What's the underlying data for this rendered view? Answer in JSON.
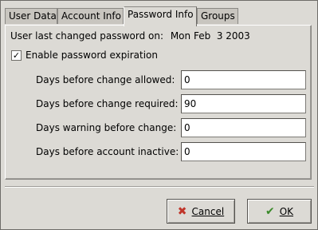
{
  "tabs": [
    {
      "label": "User Data"
    },
    {
      "label": "Account Info"
    },
    {
      "label": "Password Info"
    },
    {
      "label": "Groups"
    }
  ],
  "last_changed": {
    "label": "User last changed password on:",
    "value": "Mon Feb  3 2003"
  },
  "enable_expiration": {
    "label": "Enable password expiration",
    "checked": true
  },
  "fields": [
    {
      "label": "Days before change allowed:",
      "value": "0"
    },
    {
      "label": "Days before change required:",
      "value": "90"
    },
    {
      "label": "Days warning before change:",
      "value": "0"
    },
    {
      "label": "Days before account inactive:",
      "value": "0"
    }
  ],
  "buttons": {
    "cancel": {
      "label": "Cancel",
      "icon": "cancel-x-icon",
      "icon_color": "#c0352a"
    },
    "ok": {
      "label": "OK",
      "icon": "checkmark-icon",
      "icon_color": "#3a8a2a"
    }
  }
}
